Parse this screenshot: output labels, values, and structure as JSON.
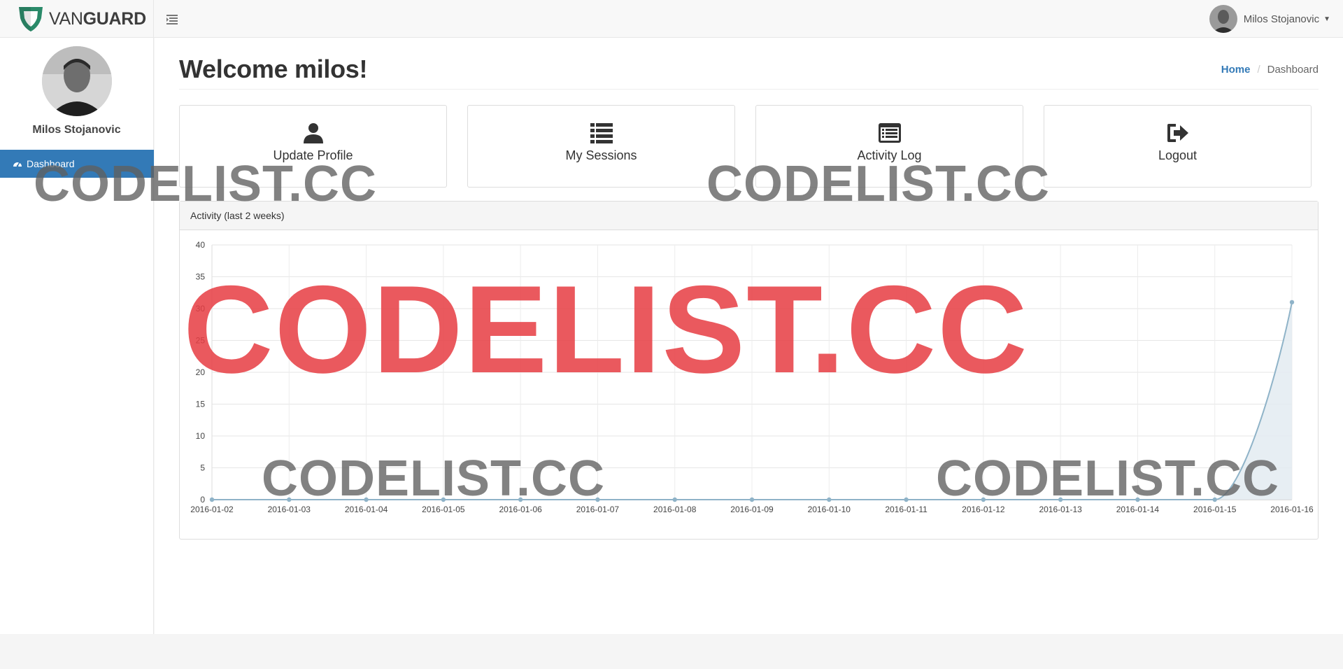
{
  "app": {
    "brand_prefix": "VAN",
    "brand_suffix": "GUARD",
    "brand_color": "#2a8a69"
  },
  "header": {
    "user_name": "Milos Stojanovic"
  },
  "sidebar": {
    "profile_name": "Milos Stojanovic",
    "items": [
      {
        "label": "Dashboard",
        "icon": "dashboard-icon",
        "active": true
      }
    ],
    "active_color": "#337ab7"
  },
  "main": {
    "title": "Welcome milos!",
    "breadcrumb": {
      "home": "Home",
      "current": "Dashboard"
    },
    "cards": [
      {
        "label": "Update Profile",
        "icon": "user-icon"
      },
      {
        "label": "My Sessions",
        "icon": "list-icon"
      },
      {
        "label": "Activity Log",
        "icon": "list-alt-icon"
      },
      {
        "label": "Logout",
        "icon": "sign-out-icon"
      }
    ],
    "panel_title": "Activity (last 2 weeks)"
  },
  "chart_data": {
    "type": "area",
    "x": [
      "2016-01-02",
      "2016-01-03",
      "2016-01-04",
      "2016-01-05",
      "2016-01-06",
      "2016-01-07",
      "2016-01-08",
      "2016-01-09",
      "2016-01-10",
      "2016-01-11",
      "2016-01-12",
      "2016-01-13",
      "2016-01-14",
      "2016-01-15",
      "2016-01-16"
    ],
    "values": [
      0,
      0,
      0,
      0,
      0,
      0,
      0,
      0,
      0,
      0,
      0,
      0,
      0,
      0,
      31
    ],
    "ylim": [
      0,
      40
    ],
    "yticks": [
      0,
      5,
      10,
      15,
      20,
      25,
      30,
      35,
      40
    ],
    "grid": true,
    "line_color": "#8fb3c8",
    "fill_color": "#e3ebf1"
  },
  "watermarks": {
    "text": "CODELIST.CC",
    "red_color": "#e73e44",
    "gray_color": "#5f5f5f"
  }
}
